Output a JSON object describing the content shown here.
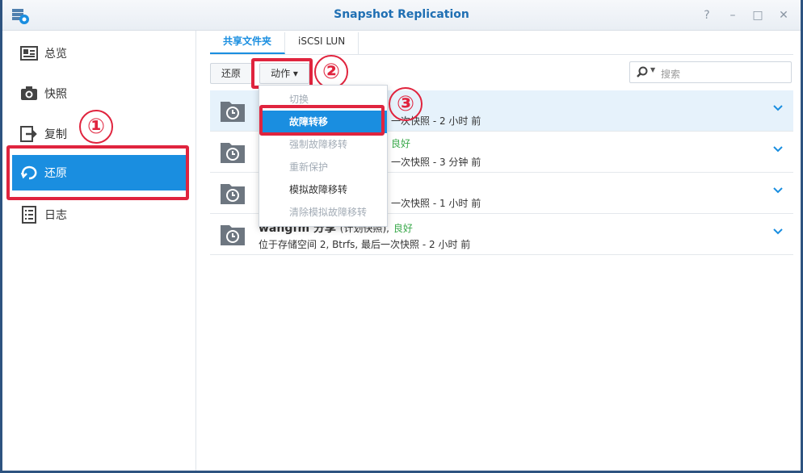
{
  "window": {
    "title": "Snapshot Replication"
  },
  "window_controls": [
    "?",
    "–",
    "□",
    "✕"
  ],
  "sidebar": {
    "items": [
      {
        "label": "总览",
        "icon": "overview-icon"
      },
      {
        "label": "快照",
        "icon": "camera-icon"
      },
      {
        "label": "复制",
        "icon": "replicate-icon"
      },
      {
        "label": "还原",
        "icon": "restore-icon",
        "active": true
      },
      {
        "label": "日志",
        "icon": "log-icon"
      }
    ]
  },
  "tabs": [
    {
      "label": "共享文件夹",
      "active": true
    },
    {
      "label": "iSCSI LUN",
      "active": false
    }
  ],
  "toolbar": {
    "restore_label": "还原",
    "action_label": "动作 ▾",
    "search_placeholder": "搜索"
  },
  "annotations": [
    "①",
    "②",
    "③"
  ],
  "dropdown": {
    "items": [
      {
        "label": "切换",
        "state": "disabled"
      },
      {
        "label": "故障转移",
        "state": "active"
      },
      {
        "label": "强制故障移转",
        "state": "disabled"
      },
      {
        "label": "重新保护",
        "state": "disabled"
      },
      {
        "label": "模拟故障移转",
        "state": "enabled"
      },
      {
        "label": "清除模拟故障移转",
        "state": "disabled"
      }
    ]
  },
  "rows": [
    {
      "name_visible": "",
      "status_visible": "",
      "good": "",
      "detail_visible": "一次快照 - 2 小时 前"
    },
    {
      "name_visible": "",
      "status_visible": "",
      "good": "良好",
      "detail_visible": "一次快照 - 3 分钟 前"
    },
    {
      "name_visible": "",
      "status_visible": "",
      "good": "",
      "detail_visible": "一次快照 - 1 小时 前"
    },
    {
      "name_visible": "wangfm 分享",
      "status_visible": "(计划快照),",
      "good": "良好",
      "detail_visible": "位于存储空间 2, Btrfs, 最后一次快照 - 2 小时 前"
    }
  ],
  "colors": {
    "accent": "#1a8ee0",
    "highlight": "#e0243e",
    "good": "#3aa94b",
    "title": "#1f6fb3"
  }
}
